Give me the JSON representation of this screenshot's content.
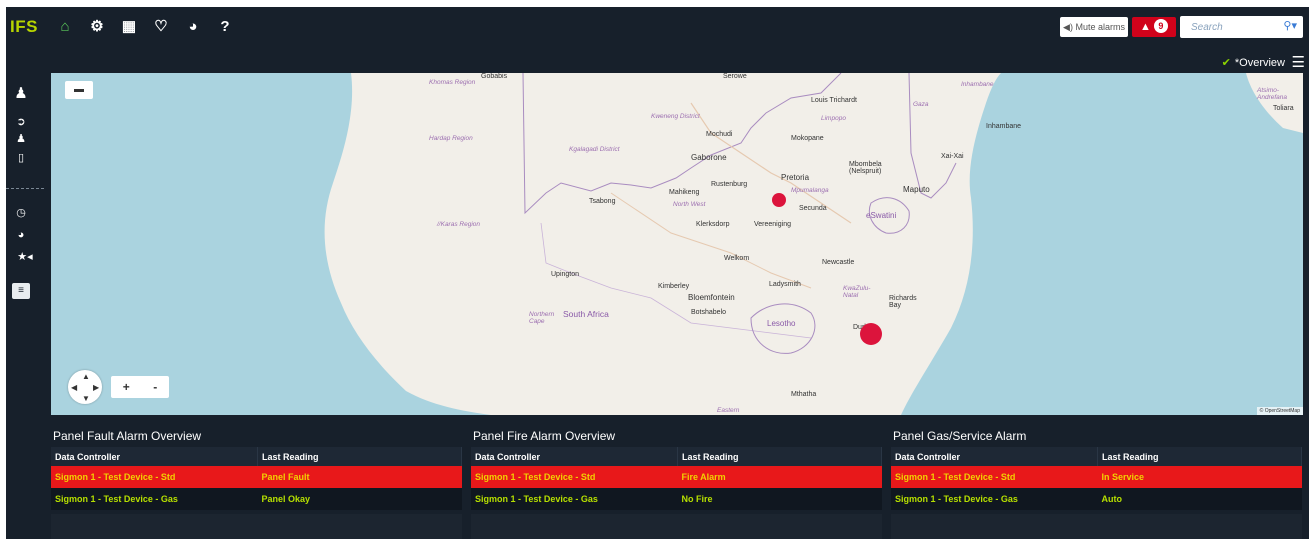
{
  "app": {
    "logo_text": "IFS",
    "nav_icons": [
      "home-icon",
      "gear-icon",
      "grid-icon",
      "bell-icon",
      "dashboard-icon",
      "help-icon"
    ]
  },
  "topbar": {
    "mute_label": "◀) Mute alarms",
    "alarm_count": "9",
    "search_placeholder": "Search"
  },
  "overview": {
    "label": "*Overview"
  },
  "map": {
    "attribution": "© OpenStreetMap",
    "labels": {
      "khomas": "Khomas Region",
      "hardap": "Hardap Region",
      "karas": "//Karas Region",
      "gobabis": "Gobabis",
      "serowe": "Serowe",
      "kweneng": "Kweneng District",
      "kgalagadi": "Kgalagadi District",
      "mochudi": "Mochudi",
      "gaborone": "Gaborone",
      "louis": "Louis Trichardt",
      "limpopo": "Limpopo",
      "mokopane": "Mokopane",
      "gaza": "Gaza",
      "inhambane_r": "Inhambane",
      "inhambane": "Inhambane",
      "atsimo": "Atsimo-Andrefana",
      "toliara": "Toliara",
      "xaixai": "Xai-Xai",
      "mbombela": "Mbombela (Nelspruit)",
      "maputo": "Maputo",
      "pretoria": "Pretoria",
      "mpumalanga": "Mpumalanga",
      "rustenburg": "Rustenburg",
      "mahikeng": "Mahikeng",
      "northwest": "North West",
      "tsabong": "Tsabong",
      "secunda": "Secunda",
      "eswatini": "eSwatini",
      "klerksdorp": "Klerksdorp",
      "vereeniging": "Vereeniging",
      "welkom": "Welkom",
      "newcastle": "Newcastle",
      "upington": "Upington",
      "kimberley": "Kimberley",
      "ladysmith": "Ladysmith",
      "kwazulu": "KwaZulu-Natal",
      "richards": "Richards Bay",
      "bloemfontein": "Bloemfontein",
      "botshabelo": "Botshabelo",
      "northern_cape": "Northern Cape",
      "south_africa": "South Africa",
      "lesotho": "Lesotho",
      "durban": "Durban",
      "mthatha": "Mthatha",
      "eastern": "Eastern"
    }
  },
  "panels": [
    {
      "title": "Panel Fault Alarm Overview",
      "columns": [
        "Data Controller",
        "Last Reading"
      ],
      "rows": [
        {
          "controller": "Sigmon 1 - Test Device - Std",
          "reading": "Panel Fault"
        },
        {
          "controller": "Sigmon 1 - Test Device - Gas",
          "reading": "Panel Okay"
        }
      ]
    },
    {
      "title": "Panel Fire Alarm Overview",
      "columns": [
        "Data Controller",
        "Last Reading"
      ],
      "rows": [
        {
          "controller": "Sigmon 1 - Test Device - Std",
          "reading": "Fire Alarm"
        },
        {
          "controller": "Sigmon 1 - Test Device - Gas",
          "reading": "No Fire"
        }
      ]
    },
    {
      "title": "Panel Gas/Service Alarm",
      "columns": [
        "Data Controller",
        "Last Reading"
      ],
      "rows": [
        {
          "controller": "Sigmon 1 - Test Device - Std",
          "reading": "In Service"
        },
        {
          "controller": "Sigmon 1 - Test Device - Gas",
          "reading": "Auto"
        }
      ]
    }
  ],
  "colors": {
    "background": "#17202b",
    "alarm_row": "#e8181a",
    "alarm_text": "#f1d100",
    "ok_text": "#b7e000",
    "marker": "#dc143c",
    "accent_green": "#8bd300"
  }
}
